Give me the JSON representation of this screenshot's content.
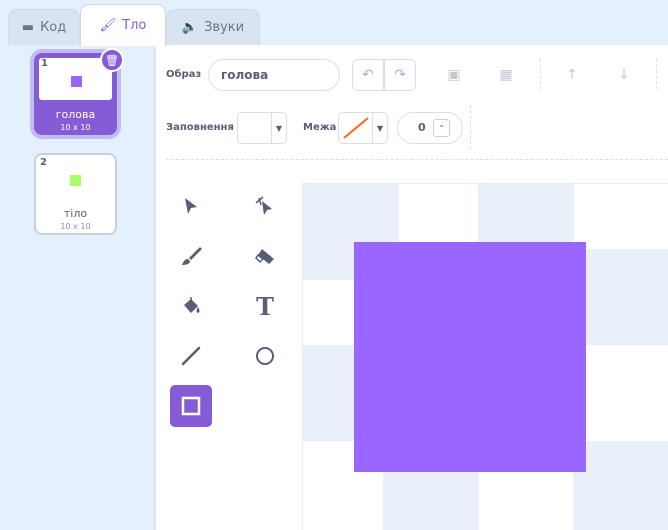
{
  "tabs": [
    {
      "label": "Код",
      "icon": "code-icon"
    },
    {
      "label": "Тло",
      "icon": "brush-icon"
    },
    {
      "label": "Звуки",
      "icon": "speaker-icon"
    }
  ],
  "costumes": [
    {
      "number": "1",
      "name": "голова",
      "size": "10 x 10",
      "color": "#9966ff"
    },
    {
      "number": "2",
      "name": "тіло",
      "size": "10 x 10",
      "color": "#a6ff66"
    }
  ],
  "toolbar": {
    "costume_label": "Образ",
    "costume_name": "голова",
    "fill_label": "Заповнення",
    "outline_label": "Межа",
    "outline_width": "0"
  },
  "colors": {
    "accent": "#855cd6",
    "shape_fill": "#9966ff",
    "fill_swatch": "#ffffff",
    "outline_swatch": "none"
  },
  "tools": [
    {
      "name": "select",
      "glyph": "➤",
      "active": false
    },
    {
      "name": "reshape",
      "glyph": "✦",
      "active": false
    },
    {
      "name": "brush",
      "glyph": "🖌",
      "active": false
    },
    {
      "name": "eraser",
      "glyph": "⌫",
      "active": false
    },
    {
      "name": "fill",
      "glyph": "⛀",
      "active": false
    },
    {
      "name": "text",
      "glyph": "T",
      "active": false
    },
    {
      "name": "line",
      "glyph": "╱",
      "active": false
    },
    {
      "name": "circle",
      "glyph": "○",
      "active": false
    },
    {
      "name": "rectangle",
      "glyph": "□",
      "active": true
    }
  ]
}
